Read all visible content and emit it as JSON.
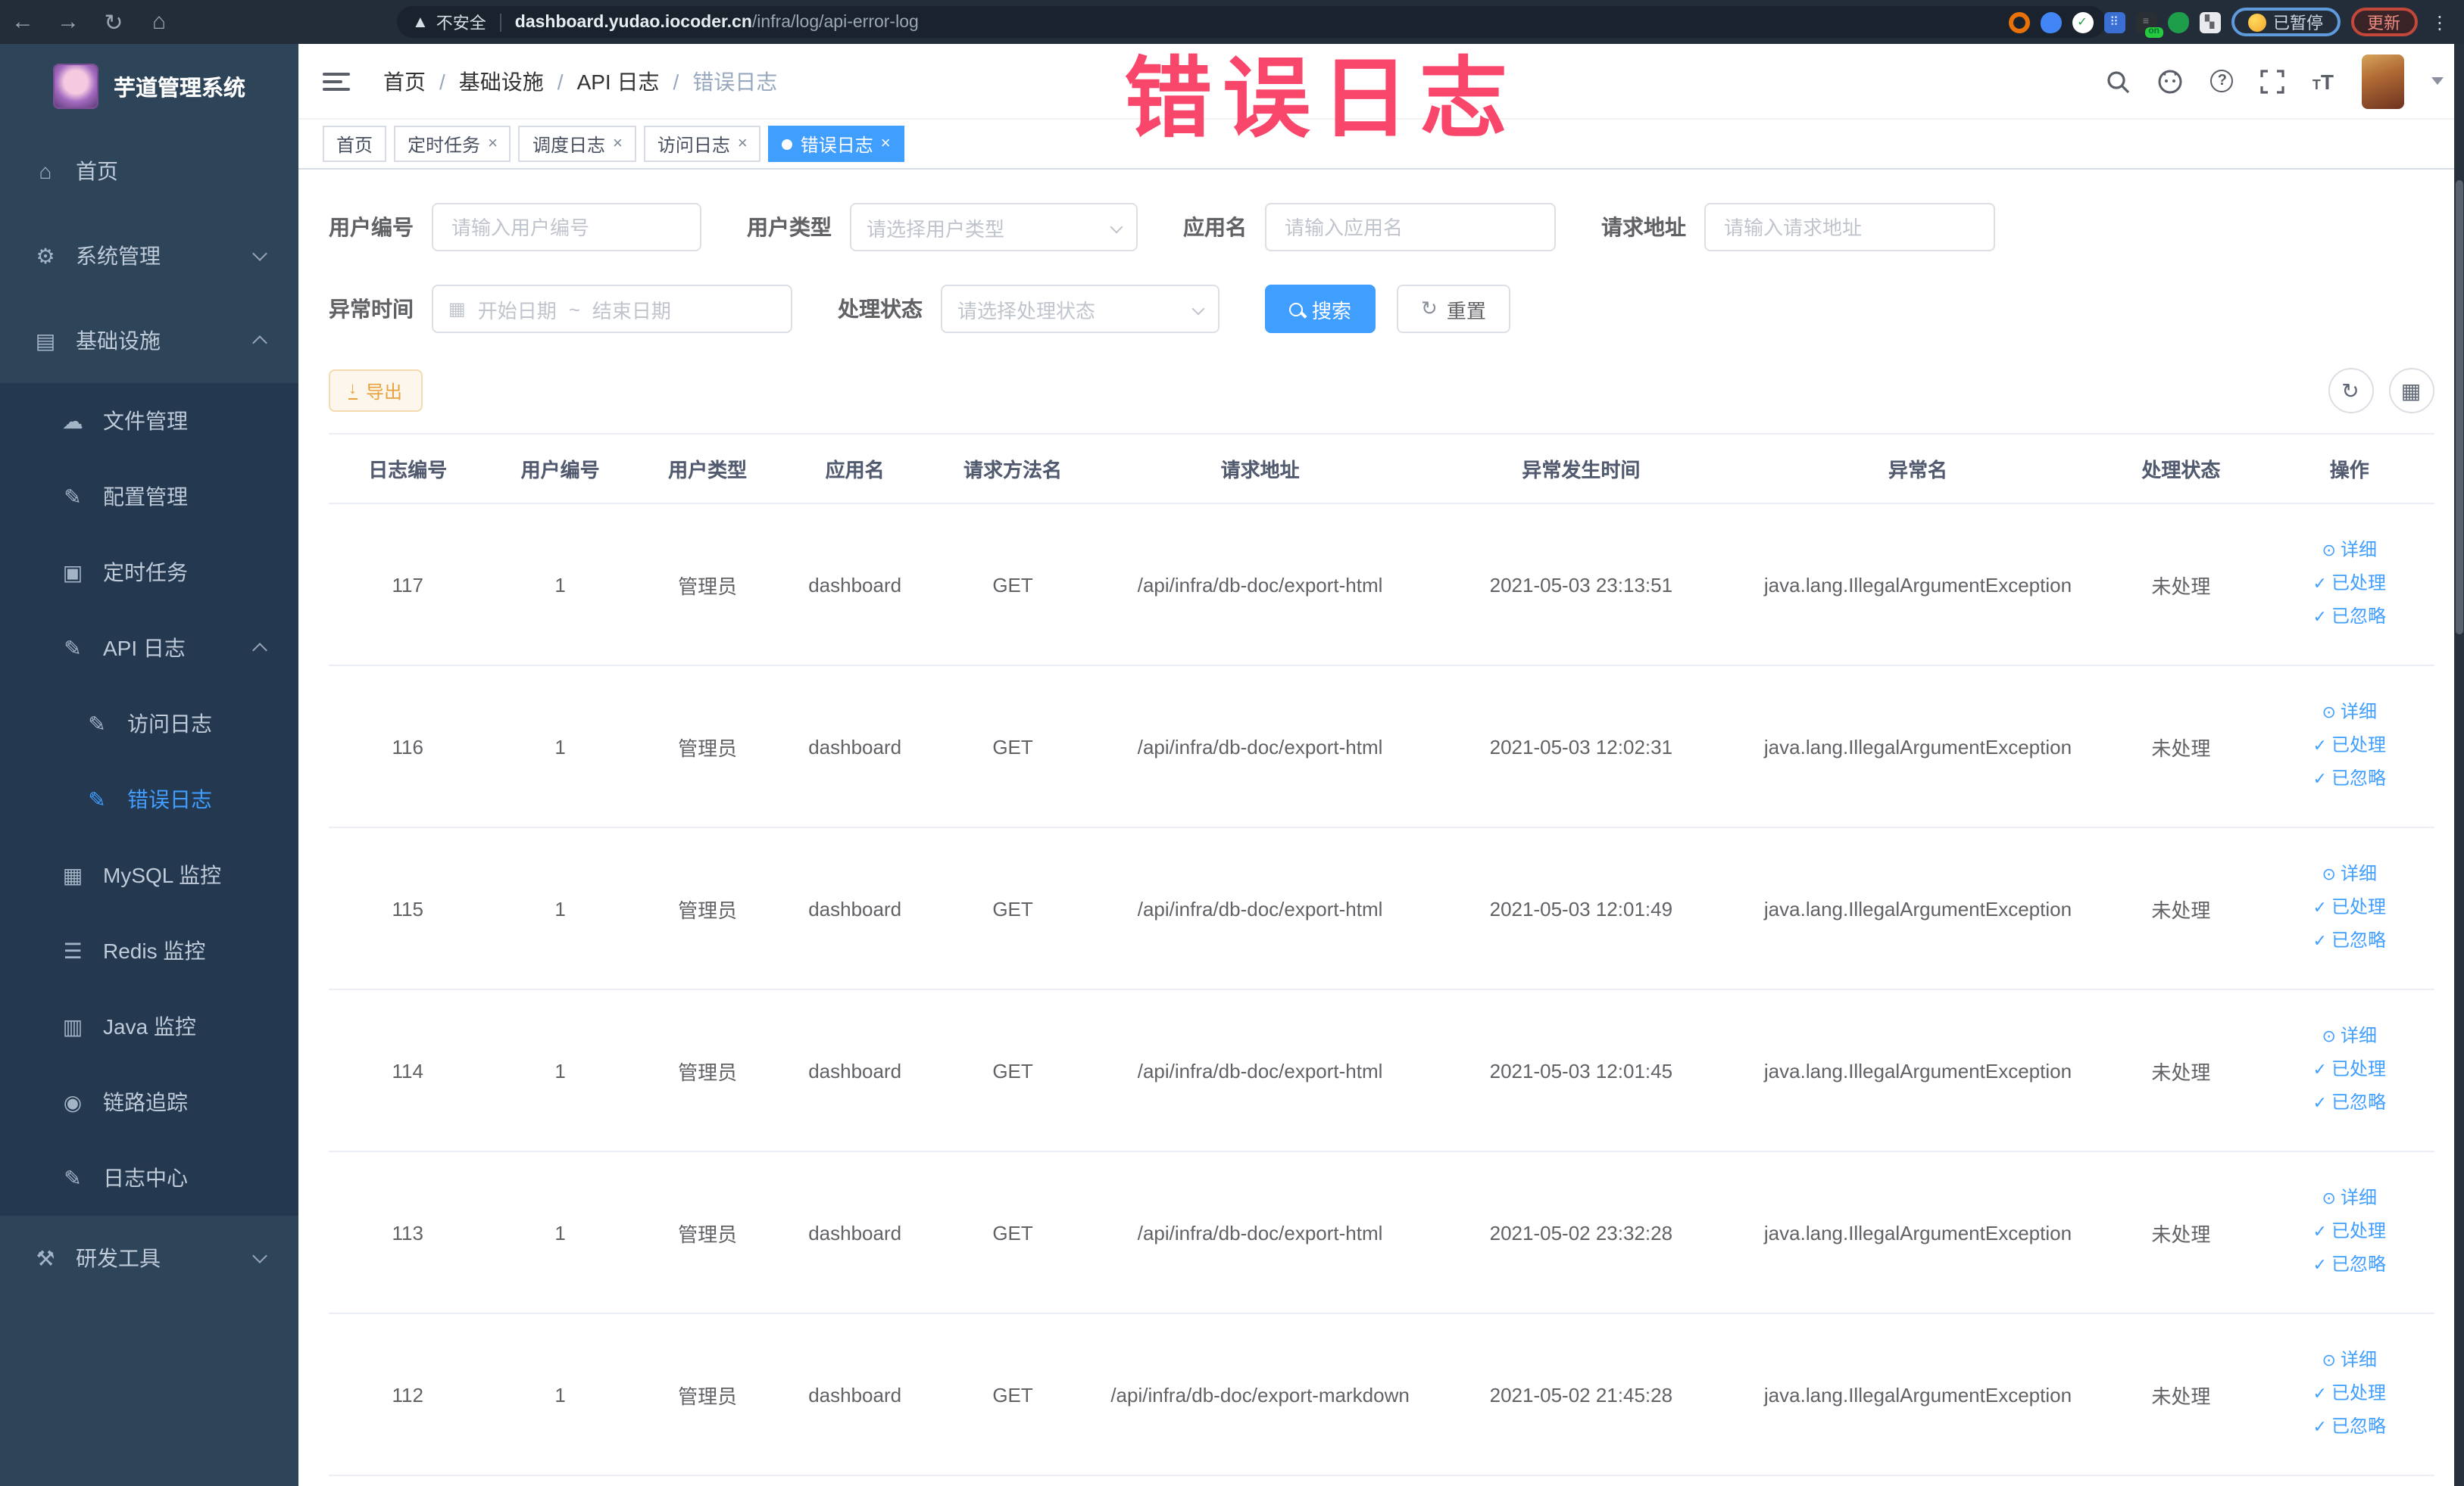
{
  "browser": {
    "security_label": "不安全",
    "url_host": "dashboard.yudao.iocoder.cn",
    "url_path": "/infra/log/api-error-log",
    "extension_on_badge": "on",
    "paused_pill": "已暂停",
    "update_pill": "更新"
  },
  "watermark": "错误日志",
  "sidebar": {
    "title": "芋道管理系统",
    "items": [
      {
        "label": "首页",
        "icon": "home-icon"
      },
      {
        "label": "系统管理",
        "icon": "gear-icon",
        "chevron": "down"
      },
      {
        "label": "基础设施",
        "icon": "infra-icon",
        "chevron": "up"
      },
      {
        "label": "文件管理",
        "icon": "upload-cloud-icon"
      },
      {
        "label": "配置管理",
        "icon": "edit-icon"
      },
      {
        "label": "定时任务",
        "icon": "document-icon"
      },
      {
        "label": "API 日志",
        "icon": "log-icon",
        "chevron": "up"
      },
      {
        "label": "访问日志",
        "icon": "log-icon"
      },
      {
        "label": "错误日志",
        "icon": "log-icon",
        "active": true
      },
      {
        "label": "MySQL 监控",
        "icon": "image-icon"
      },
      {
        "label": "Redis 监控",
        "icon": "layers-icon"
      },
      {
        "label": "Java 监控",
        "icon": "monitor-icon"
      },
      {
        "label": "链路追踪",
        "icon": "eye-icon"
      },
      {
        "label": "日志中心",
        "icon": "log-icon"
      },
      {
        "label": "研发工具",
        "icon": "toolbox-icon",
        "chevron": "down"
      }
    ]
  },
  "header": {
    "breadcrumb": [
      "首页",
      "基础设施",
      "API 日志",
      "错误日志"
    ]
  },
  "tabs": [
    {
      "label": "首页",
      "closable": false,
      "active": false
    },
    {
      "label": "定时任务",
      "closable": true,
      "active": false
    },
    {
      "label": "调度日志",
      "closable": true,
      "active": false
    },
    {
      "label": "访问日志",
      "closable": true,
      "active": false
    },
    {
      "label": "错误日志",
      "closable": true,
      "active": true
    }
  ],
  "filters": {
    "user_id": {
      "label": "用户编号",
      "placeholder": "请输入用户编号"
    },
    "user_type": {
      "label": "用户类型",
      "placeholder": "请选择用户类型"
    },
    "app_name": {
      "label": "应用名",
      "placeholder": "请输入应用名"
    },
    "request_url": {
      "label": "请求地址",
      "placeholder": "请输入请求地址"
    },
    "exception_time": {
      "label": "异常时间",
      "start_placeholder": "开始日期",
      "separator": "~",
      "end_placeholder": "结束日期"
    },
    "process_status": {
      "label": "处理状态",
      "placeholder": "请选择处理状态"
    },
    "search_button": "搜索",
    "reset_button": "重置"
  },
  "toolbar": {
    "export_button": "导出"
  },
  "table": {
    "headers": [
      "日志编号",
      "用户编号",
      "用户类型",
      "应用名",
      "请求方法名",
      "请求地址",
      "异常发生时间",
      "异常名",
      "处理状态",
      "操作"
    ],
    "action_labels": {
      "detail": "详细",
      "processed": "已处理",
      "ignored": "已忽略"
    },
    "rows": [
      {
        "id": "117",
        "user_id": "1",
        "user_type": "管理员",
        "app": "dashboard",
        "method": "GET",
        "url": "/api/infra/db-doc/export-html",
        "time": "2021-05-03 23:13:51",
        "exception": "java.lang.IllegalArgumentException",
        "status": "未处理"
      },
      {
        "id": "116",
        "user_id": "1",
        "user_type": "管理员",
        "app": "dashboard",
        "method": "GET",
        "url": "/api/infra/db-doc/export-html",
        "time": "2021-05-03 12:02:31",
        "exception": "java.lang.IllegalArgumentException",
        "status": "未处理"
      },
      {
        "id": "115",
        "user_id": "1",
        "user_type": "管理员",
        "app": "dashboard",
        "method": "GET",
        "url": "/api/infra/db-doc/export-html",
        "time": "2021-05-03 12:01:49",
        "exception": "java.lang.IllegalArgumentException",
        "status": "未处理"
      },
      {
        "id": "114",
        "user_id": "1",
        "user_type": "管理员",
        "app": "dashboard",
        "method": "GET",
        "url": "/api/infra/db-doc/export-html",
        "time": "2021-05-03 12:01:45",
        "exception": "java.lang.IllegalArgumentException",
        "status": "未处理"
      },
      {
        "id": "113",
        "user_id": "1",
        "user_type": "管理员",
        "app": "dashboard",
        "method": "GET",
        "url": "/api/infra/db-doc/export-html",
        "time": "2021-05-02 23:32:28",
        "exception": "java.lang.IllegalArgumentException",
        "status": "未处理"
      },
      {
        "id": "112",
        "user_id": "1",
        "user_type": "管理员",
        "app": "dashboard",
        "method": "GET",
        "url": "/api/infra/db-doc/export-markdown",
        "time": "2021-05-02 21:45:28",
        "exception": "java.lang.IllegalArgumentException",
        "status": "未处理"
      }
    ]
  },
  "colors": {
    "accent": "#409eff",
    "warning": "#e6a23c",
    "watermark": "#f9466b",
    "sidebar_bg": "#2e4459",
    "submenu_bg": "#243850"
  }
}
